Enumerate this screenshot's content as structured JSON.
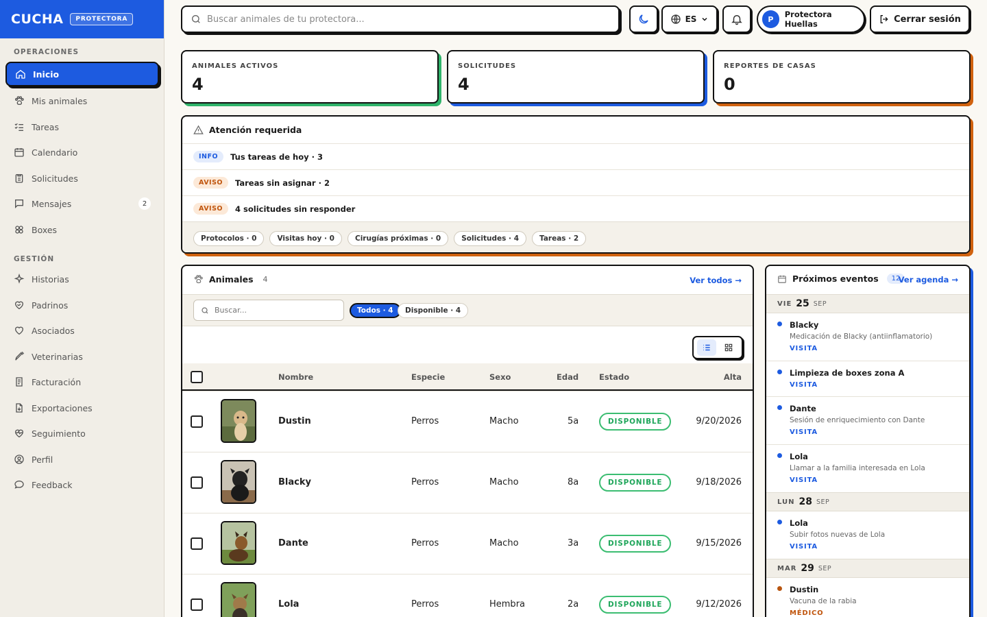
{
  "brand": {
    "name": "CUCHA",
    "badge": "PROTECTORA"
  },
  "sidebar": {
    "operaciones_title": "OPERACIONES",
    "gestion_title": "GESTIÓN",
    "operaciones": [
      {
        "label": "Inicio",
        "icon": "home-icon"
      },
      {
        "label": "Mis animales",
        "icon": "paw-icon"
      },
      {
        "label": "Tareas",
        "icon": "tasks-icon"
      },
      {
        "label": "Calendario",
        "icon": "calendar-icon"
      },
      {
        "label": "Solicitudes",
        "icon": "clipboard-icon"
      },
      {
        "label": "Mensajes",
        "icon": "message-icon",
        "count": "2"
      },
      {
        "label": "Boxes",
        "icon": "boxes-icon"
      }
    ],
    "gestion": [
      {
        "label": "Historias",
        "icon": "sparkle-icon"
      },
      {
        "label": "Padrinos",
        "icon": "heart-handshake-icon"
      },
      {
        "label": "Asociados",
        "icon": "heart-icon"
      },
      {
        "label": "Veterinarias",
        "icon": "syringe-icon"
      },
      {
        "label": "Facturación",
        "icon": "receipt-icon"
      },
      {
        "label": "Exportaciones",
        "icon": "file-export-icon"
      },
      {
        "label": "Seguimiento",
        "icon": "heart-pulse-icon"
      },
      {
        "label": "Perfil",
        "icon": "user-circle-icon"
      },
      {
        "label": "Feedback",
        "icon": "chat-icon"
      }
    ]
  },
  "topbar": {
    "search_placeholder": "Buscar animales de tu protectora...",
    "language": "ES",
    "avatar_letter": "P",
    "user_name": "Protectora Huellas",
    "logout": "Cerrar sesión"
  },
  "stats": [
    {
      "label": "ANIMALES ACTIVOS",
      "value": "4",
      "color": "#2fb36a"
    },
    {
      "label": "SOLICITUDES",
      "value": "4",
      "color": "#1d5be0"
    },
    {
      "label": "REPORTES DE CASAS",
      "value": "0",
      "color": "#d0620f"
    }
  ],
  "attention": {
    "title": "Atención requerida",
    "rows": [
      {
        "tag": "INFO",
        "kind": "info",
        "text": "Tus tareas de hoy · 3"
      },
      {
        "tag": "AVISO",
        "kind": "aviso",
        "text": "Tareas sin asignar · 2"
      },
      {
        "tag": "AVISO",
        "kind": "aviso",
        "text": "4 solicitudes sin responder"
      }
    ],
    "chips": [
      "Protocolos · 0",
      "Visitas hoy · 0",
      "Cirugías próximas · 0",
      "Solicitudes · 4",
      "Tareas · 2"
    ]
  },
  "animals": {
    "title": "Animales",
    "count": "4",
    "see_all": "Ver todos →",
    "search_placeholder": "Buscar...",
    "filter_all": "Todos · 4",
    "filter_available": "Disponible · 4",
    "columns": {
      "name": "Nombre",
      "species": "Especie",
      "sex": "Sexo",
      "age": "Edad",
      "status": "Estado",
      "date": "Alta"
    },
    "rows": [
      {
        "name": "Dustin",
        "species": "Perros",
        "sex": "Macho",
        "age": "5a",
        "status": "DISPONIBLE",
        "date": "9/20/2026"
      },
      {
        "name": "Blacky",
        "species": "Perros",
        "sex": "Macho",
        "age": "8a",
        "status": "DISPONIBLE",
        "date": "9/18/2026"
      },
      {
        "name": "Dante",
        "species": "Perros",
        "sex": "Macho",
        "age": "3a",
        "status": "DISPONIBLE",
        "date": "9/15/2026"
      },
      {
        "name": "Lola",
        "species": "Perros",
        "sex": "Hembra",
        "age": "2a",
        "status": "DISPONIBLE",
        "date": "9/12/2026"
      }
    ]
  },
  "events": {
    "title": "Próximos eventos",
    "count": "12",
    "see_agenda": "Ver agenda →",
    "days": [
      {
        "dow": "VIE",
        "day": "25",
        "month": "SEP",
        "items": [
          {
            "title": "Blacky",
            "desc": "Medicación de Blacky (antiinflamatorio)",
            "type": "VISITA"
          },
          {
            "title": "Limpieza de boxes zona A",
            "desc": "",
            "type": "VISITA"
          },
          {
            "title": "Dante",
            "desc": "Sesión de enriquecimiento con Dante",
            "type": "VISITA"
          },
          {
            "title": "Lola",
            "desc": "Llamar a la familia interesada en Lola",
            "type": "VISITA"
          }
        ]
      },
      {
        "dow": "LUN",
        "day": "28",
        "month": "SEP",
        "items": [
          {
            "title": "Lola",
            "desc": "Subir fotos nuevas de Lola",
            "type": "VISITA"
          }
        ]
      },
      {
        "dow": "MAR",
        "day": "29",
        "month": "SEP",
        "items": [
          {
            "title": "Dustin",
            "desc": "Vacuna de la rabia",
            "type": "MÉDICO"
          }
        ]
      }
    ]
  }
}
